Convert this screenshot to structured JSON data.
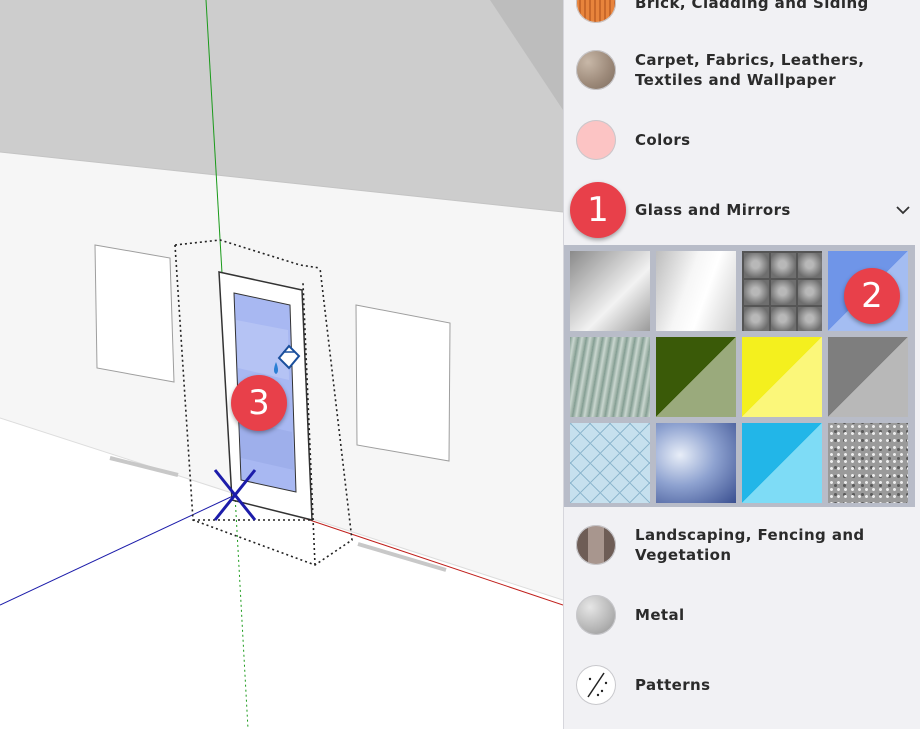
{
  "categories_above": [
    {
      "label": "Brick, Cladding and Siding",
      "icon": "brick-swatch-icon"
    },
    {
      "label": "Carpet, Fabrics, Leathers, Textiles and Wallpaper",
      "icon": "carpet-swatch-icon"
    },
    {
      "label": "Colors",
      "icon": "colors-swatch-icon"
    },
    {
      "label": "Glass and Mirrors",
      "icon": "chevron-down-icon",
      "expanded": true
    }
  ],
  "categories_below": [
    {
      "label": "Landscaping, Fencing and Vegetation",
      "icon": "landscaping-swatch-icon"
    },
    {
      "label": "Metal",
      "icon": "metal-swatch-icon"
    },
    {
      "label": "Patterns",
      "icon": "patterns-swatch-icon"
    }
  ],
  "swatch_count": 12,
  "callouts": {
    "one": "1",
    "two": "2",
    "three": "3"
  },
  "colors": {
    "panel_bg": "#f1f1f4",
    "grid_bg": "#b8bcc8",
    "callout": "#e8404a",
    "selected_swatch": "#6f95e8"
  }
}
